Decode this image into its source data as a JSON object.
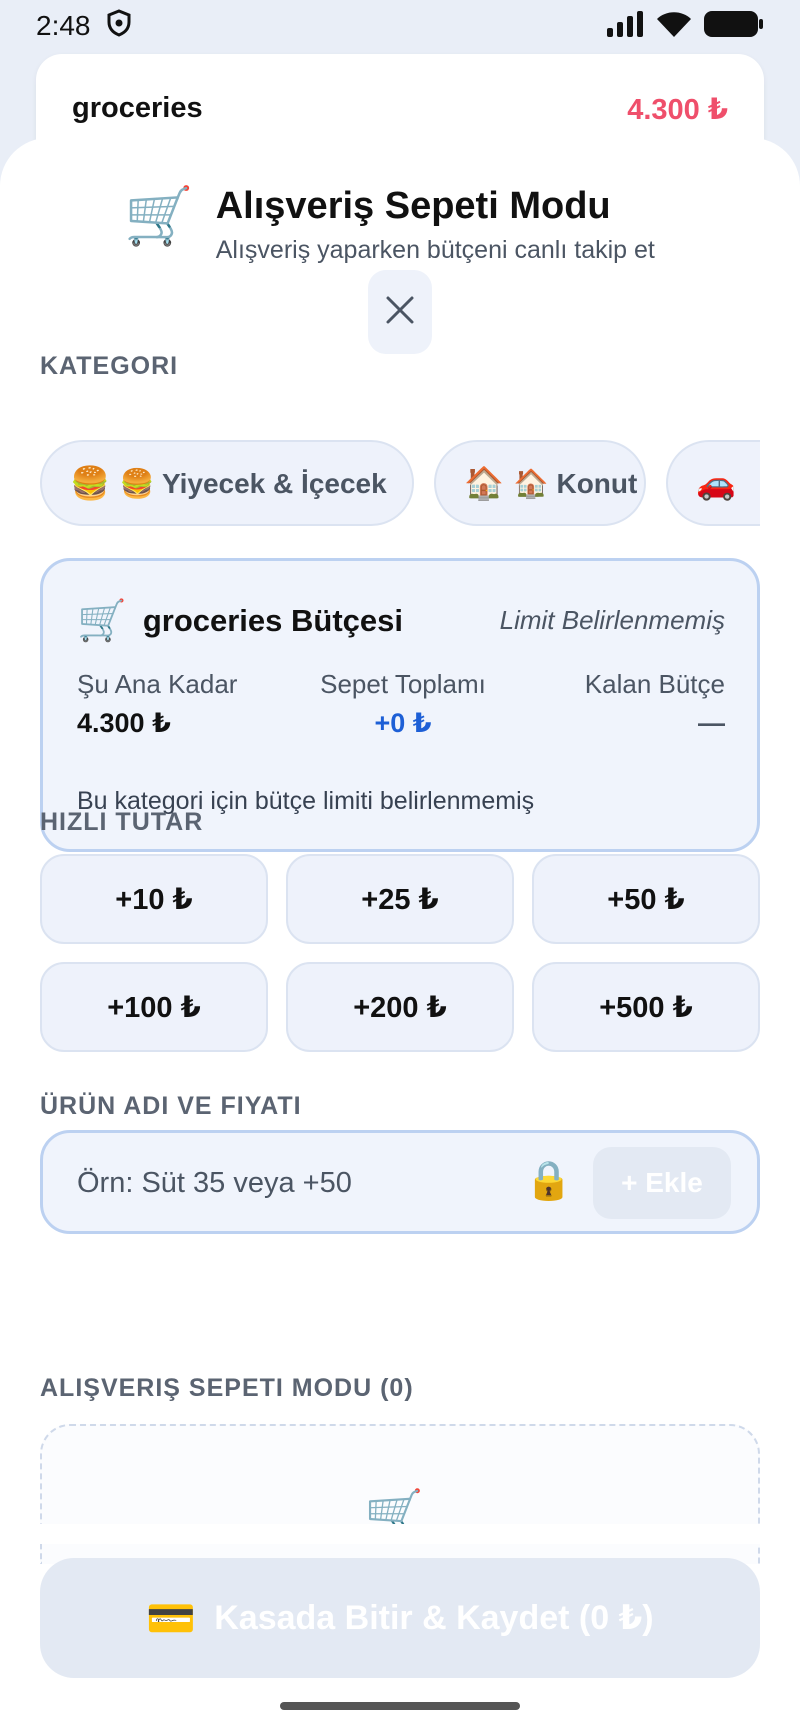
{
  "status_bar": {
    "time": "2:48"
  },
  "background_card": {
    "name": "groceries",
    "amount": "4.300 ₺"
  },
  "header": {
    "title": "Alışveriş Sepeti Modu",
    "subtitle": "Alışveriş yaparken bütçeni canlı takip et"
  },
  "category": {
    "label": "KATEGORI",
    "chips": [
      {
        "emoji": "🍔",
        "label": "🍔 Yiyecek & İçecek"
      },
      {
        "emoji": "🏠",
        "label": "🏠 Konut"
      },
      {
        "emoji": "🚗",
        "label": ""
      }
    ]
  },
  "budget": {
    "title": "groceries Bütçesi",
    "limit_status": "Limit Belirlenmemiş",
    "so_far_label": "Şu Ana Kadar",
    "so_far_value": "4.300 ₺",
    "cart_total_label": "Sepet Toplamı",
    "cart_total_value": "+0 ₺",
    "remaining_label": "Kalan Bütçe",
    "remaining_value": "—",
    "note": "Bu kategori için bütçe limiti belirlenmemiş",
    "accent_color": "#1d5fd6"
  },
  "quick_amount": {
    "label": "HIZLI TUTAR",
    "buttons": [
      "+10 ₺",
      "+25 ₺",
      "+50 ₺",
      "+100 ₺",
      "+200 ₺",
      "+500 ₺"
    ]
  },
  "product": {
    "label": "ÜRÜN ADI VE FIYATI",
    "placeholder": "Örn: Süt 35 veya +50",
    "value": "",
    "add_label": "+ Ekle"
  },
  "cart": {
    "label": "ALIŞVERIŞ SEPETI MODU (0)"
  },
  "finish": {
    "label": "Kasada Bitir & Kaydet (0 ₺)"
  },
  "icons": {
    "shield": "shield-icon",
    "signal": "signal-icon",
    "wifi": "wifi-icon",
    "battery": "battery-icon",
    "cart": "shopping-cart-icon",
    "close": "close-icon",
    "lock": "lock-icon",
    "credit_card": "credit-card-icon"
  }
}
